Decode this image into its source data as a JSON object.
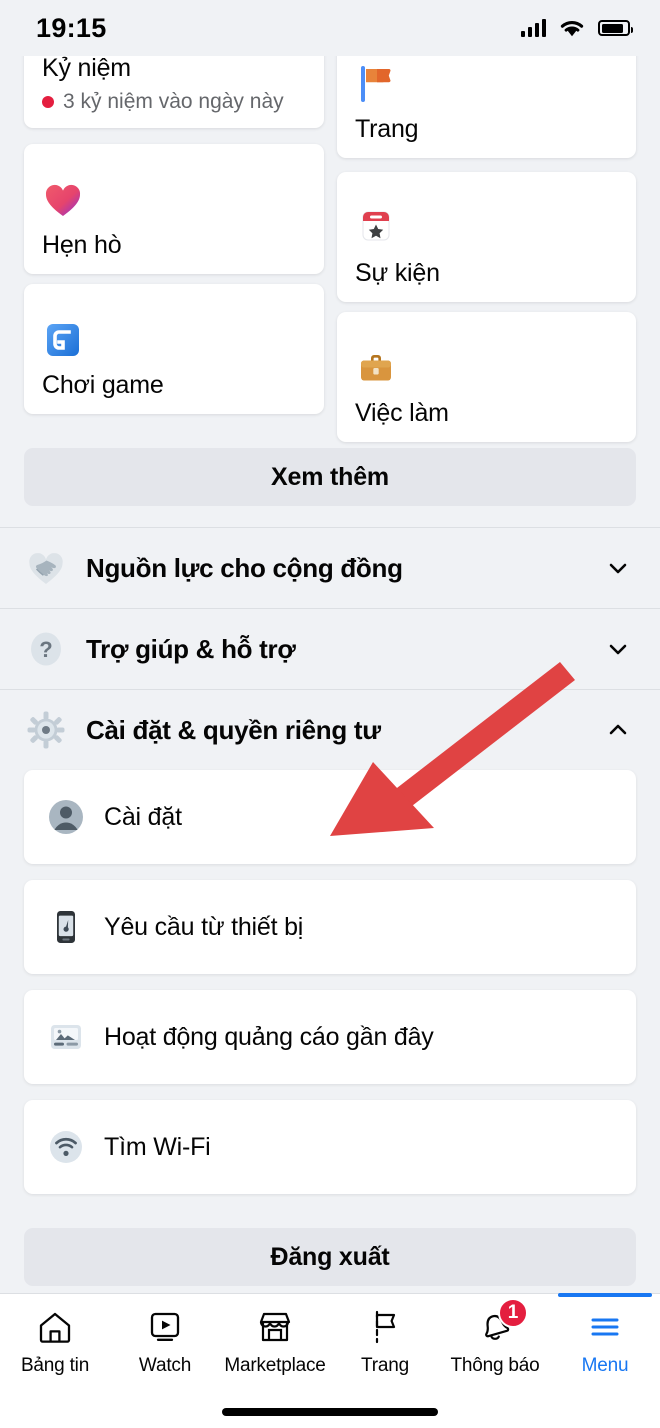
{
  "statusbar": {
    "time": "19:15",
    "signal_icon": "cellular-signal-icon",
    "wifi_icon": "wifi-icon",
    "battery_icon": "battery-icon"
  },
  "shortcuts": {
    "cards": [
      {
        "id": "memories",
        "icon": "memories-icon",
        "title": "Kỷ niệm",
        "subtitle": "3 kỷ niệm vào ngày này",
        "badge_color": "#E41E3F"
      },
      {
        "id": "pages",
        "icon": "flag-icon",
        "title": "Trang",
        "subtitle": ""
      },
      {
        "id": "dating",
        "icon": "heart-icon",
        "title": "Hẹn hò",
        "subtitle": ""
      },
      {
        "id": "events",
        "icon": "calendar-star-icon",
        "title": "Sự kiện",
        "subtitle": ""
      },
      {
        "id": "gaming",
        "icon": "gaming-icon",
        "title": "Chơi game",
        "subtitle": ""
      },
      {
        "id": "jobs",
        "icon": "briefcase-icon",
        "title": "Việc làm",
        "subtitle": ""
      }
    ],
    "see_more_label": "Xem thêm"
  },
  "sections": [
    {
      "id": "community-resources",
      "icon": "handshake-heart-icon",
      "label": "Nguồn lực cho cộng đồng",
      "expanded": false,
      "chevron": "chevron-down-icon"
    },
    {
      "id": "help-support",
      "icon": "question-mark-icon",
      "label": "Trợ giúp & hỗ trợ",
      "expanded": false,
      "chevron": "chevron-down-icon"
    },
    {
      "id": "settings-privacy",
      "icon": "gear-icon",
      "label": "Cài đặt & quyền riêng tư",
      "expanded": true,
      "chevron": "chevron-up-icon"
    }
  ],
  "settings_items": [
    {
      "id": "settings",
      "icon": "avatar-icon",
      "label": "Cài đặt"
    },
    {
      "id": "device-requests",
      "icon": "mobile-phone-icon",
      "label": "Yêu cầu từ thiết bị"
    },
    {
      "id": "ad-activity",
      "icon": "ad-activity-icon",
      "label": "Hoạt động quảng cáo gần đây"
    },
    {
      "id": "find-wifi",
      "icon": "wifi-find-icon",
      "label": "Tìm Wi-Fi"
    }
  ],
  "logout": {
    "label": "Đăng xuất"
  },
  "annotation": {
    "type": "arrow",
    "color": "#E04343",
    "points_to": "Cài đặt"
  },
  "tabbar": {
    "active": "menu",
    "accent_color": "#1877F2",
    "items": [
      {
        "id": "newsfeed",
        "icon": "home-icon",
        "label": "Bảng tin",
        "badge": ""
      },
      {
        "id": "watch",
        "icon": "play-video-icon",
        "label": "Watch",
        "badge": ""
      },
      {
        "id": "marketplace",
        "icon": "store-icon",
        "label": "Marketplace",
        "badge": ""
      },
      {
        "id": "pages",
        "icon": "flag-outline-icon",
        "label": "Trang",
        "badge": ""
      },
      {
        "id": "notifications",
        "icon": "bell-icon",
        "label": "Thông báo",
        "badge": "1"
      },
      {
        "id": "menu",
        "icon": "hamburger-icon",
        "label": "Menu",
        "badge": ""
      }
    ]
  }
}
